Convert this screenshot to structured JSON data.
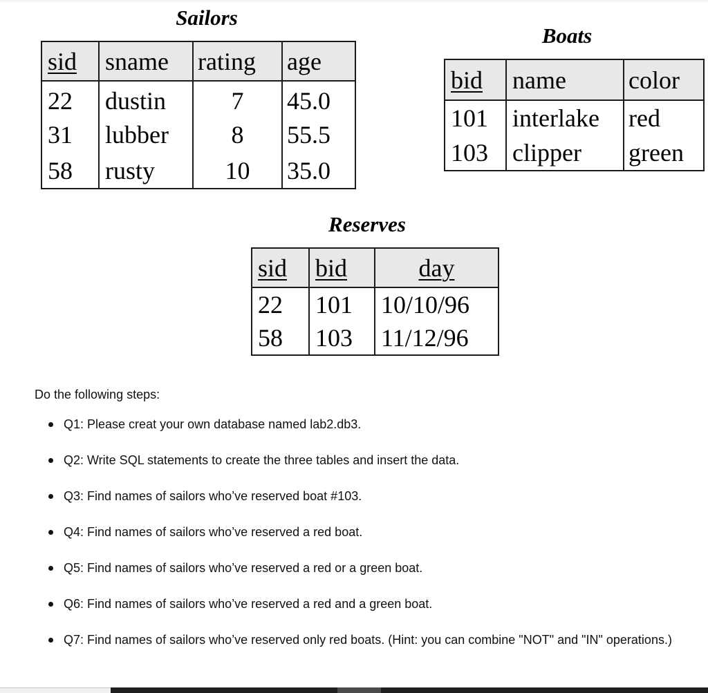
{
  "relations": {
    "sailors": {
      "title": "Sailors",
      "columns": [
        {
          "label": "sid",
          "key": true
        },
        {
          "label": "sname",
          "key": false
        },
        {
          "label": "rating",
          "key": false
        },
        {
          "label": "age",
          "key": false
        }
      ],
      "rows": [
        [
          "22",
          "dustin",
          "7",
          "45.0"
        ],
        [
          "31",
          "lubber",
          "8",
          "55.5"
        ],
        [
          "58",
          "rusty",
          "10",
          "35.0"
        ]
      ]
    },
    "boats": {
      "title": "Boats",
      "columns": [
        {
          "label": "bid",
          "key": true
        },
        {
          "label": "name",
          "key": false
        },
        {
          "label": "color",
          "key": false
        }
      ],
      "rows": [
        [
          "101",
          "interlake",
          "red"
        ],
        [
          "103",
          "clipper",
          "green"
        ]
      ]
    },
    "reserves": {
      "title": "Reserves",
      "columns": [
        {
          "label": "sid",
          "key": true
        },
        {
          "label": "bid",
          "key": true
        },
        {
          "label": "day",
          "key": true
        }
      ],
      "rows": [
        [
          "22",
          "101",
          "10/10/96"
        ],
        [
          "58",
          "103",
          "11/12/96"
        ]
      ]
    }
  },
  "instructions": {
    "intro": "Do the following steps:",
    "steps": [
      "Q1: Please creat your own database named lab2.db3.",
      "Q2: Write SQL statements to create the three tables and insert the data.",
      "Q3: Find names of sailors who’ve reserved boat #103.",
      "Q4: Find names of sailors who’ve reserved a red boat.",
      "Q5: Find names of sailors who’ve reserved a red or a green boat.",
      "Q6: Find names of sailors who’ve reserved a red and a green boat.",
      "Q7: Find names of sailors who’ve reserved only red boats. (Hint: you can combine \"NOT\" and \"IN\" operations.)"
    ]
  },
  "colors": {
    "header_fill": "#e8e8e8",
    "border": "#1a1a1a",
    "scrollbar_track": "#1e1e1e",
    "scrollbar_thumb": "#4a4a4a"
  }
}
